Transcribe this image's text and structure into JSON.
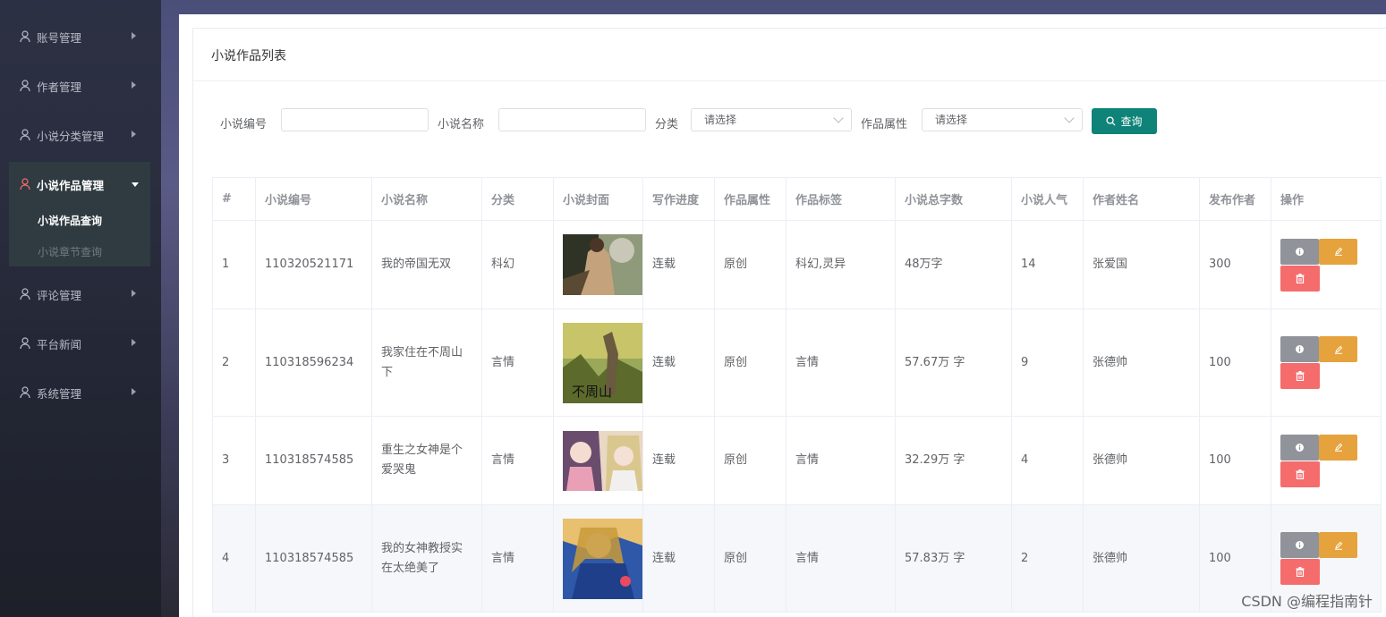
{
  "sidebar": {
    "items": [
      {
        "label": "账号管理",
        "icon": "user-icon"
      },
      {
        "label": "作者管理",
        "icon": "user-icon"
      },
      {
        "label": "小说分类管理",
        "icon": "user-icon"
      },
      {
        "label": "小说作品管理",
        "icon": "user-icon",
        "active": true
      },
      {
        "label": "评论管理",
        "icon": "user-icon"
      },
      {
        "label": "平台新闻",
        "icon": "user-icon"
      },
      {
        "label": "系统管理",
        "icon": "user-icon"
      }
    ],
    "sub_items": [
      {
        "label": "小说作品查询",
        "active": true
      },
      {
        "label": "小说章节查询",
        "active": false
      }
    ],
    "active_icon_color": "#f56c6c"
  },
  "page": {
    "title": "小说作品列表"
  },
  "filters": {
    "novel_no_label": "小说编号",
    "novel_no_value": "",
    "novel_name_label": "小说名称",
    "novel_name_value": "",
    "category_label": "分类",
    "category_placeholder": "请选择",
    "attribute_label": "作品属性",
    "attribute_placeholder": "请选择",
    "search_button": "查询"
  },
  "table": {
    "headers": [
      "#",
      "小说编号",
      "小说名称",
      "分类",
      "小说封面",
      "写作进度",
      "作品属性",
      "作品标签",
      "小说总字数",
      "小说人气",
      "作者姓名",
      "发布作者",
      "操作"
    ],
    "rows": [
      {
        "idx": "1",
        "no": "110320521171",
        "name": "我的帝国无双",
        "category": "科幻",
        "cover": "warrior-cover",
        "progress": "连载",
        "attribute": "原创",
        "tags": "科幻,灵异",
        "words": "48万字",
        "popularity": "14",
        "author": "张爱国",
        "publisher": "300"
      },
      {
        "idx": "2",
        "no": "110318596234",
        "name": "我家住在不周山下",
        "category": "言情",
        "cover": "mountain-cover",
        "cover_text": "不周山",
        "progress": "连载",
        "attribute": "原创",
        "tags": "言情",
        "words": "57.67万 字",
        "popularity": "9",
        "author": "张德帅",
        "publisher": "100"
      },
      {
        "idx": "3",
        "no": "110318574585",
        "name": "重生之女神是个爱哭鬼",
        "category": "言情",
        "cover": "anime-girls-cover",
        "progress": "连载",
        "attribute": "原创",
        "tags": "言情",
        "words": "32.29万 字",
        "popularity": "4",
        "author": "张德帅",
        "publisher": "100"
      },
      {
        "idx": "4",
        "no": "110318574585",
        "name": "我的女神教授实在太绝美了",
        "category": "言情",
        "cover": "goddess-cover",
        "progress": "连载",
        "attribute": "原创",
        "tags": "言情",
        "words": "57.83万 字",
        "popularity": "2",
        "author": "张德帅",
        "publisher": "100"
      }
    ],
    "action_icons": [
      "info-icon",
      "edit-icon",
      "delete-icon"
    ]
  },
  "colors": {
    "primary": "#0f8378",
    "info": "#909399",
    "warning": "#e6a23c",
    "danger": "#f56c6c"
  },
  "watermark": "CSDN @编程指南针"
}
